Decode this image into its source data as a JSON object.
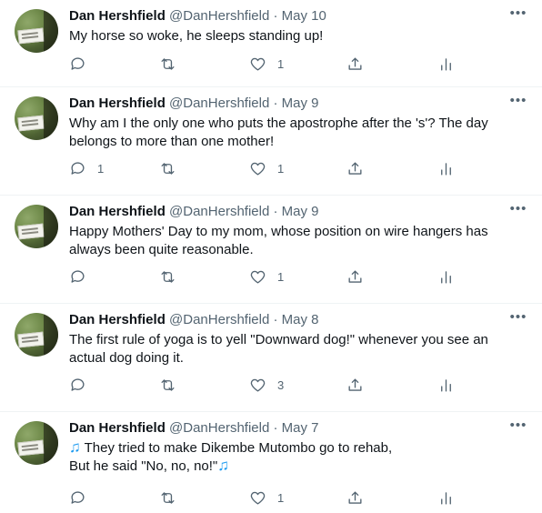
{
  "tweets": [
    {
      "name": "Dan Hershfield",
      "meta": " @DanHershfield · May 10",
      "text": "My horse so woke, he sleeps standing up!",
      "replies": "",
      "retweets": "",
      "likes": "1"
    },
    {
      "name": "Dan Hershfield",
      "meta": " @DanHershfield · May 9",
      "text": "Why am I the only one who puts the apostrophe after the 's'? The day belongs to more than one mother!",
      "replies": "1",
      "retweets": "",
      "likes": "1"
    },
    {
      "name": "Dan Hershfield",
      "meta": " @DanHershfield · May 9",
      "text": "Happy Mothers' Day to my mom, whose position on wire hangers has always been quite reasonable.",
      "replies": "",
      "retweets": "",
      "likes": "1"
    },
    {
      "name": "Dan Hershfield",
      "meta": " @DanHershfield · May 8",
      "text": "The first rule of yoga is to yell \"Downward dog!\" whenever you see an actual dog doing it.",
      "replies": "",
      "retweets": "",
      "likes": "3"
    },
    {
      "name": "Dan Hershfield",
      "meta": " @DanHershfield · May 7",
      "text_line1": " They tried to make Dikembe Mutombo go to rehab,",
      "text_line2": "But he said \"No, no, no!\"",
      "note_glyph": "♫",
      "replies": "",
      "retweets": "",
      "likes": "1"
    }
  ],
  "icons": [
    "more-icon",
    "reply-icon",
    "retweet-icon",
    "like-icon",
    "share-icon",
    "analytics-icon"
  ],
  "colors": {
    "text": "#0f1419",
    "secondary": "#536471",
    "accent": "#1d9bf0",
    "divider": "#eff3f4"
  }
}
